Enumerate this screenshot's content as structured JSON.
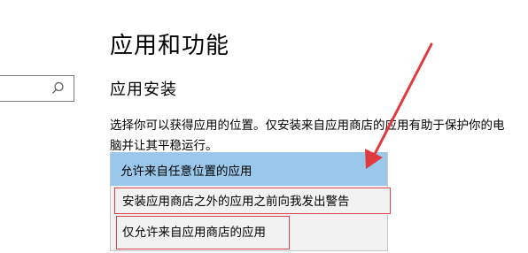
{
  "page": {
    "title": "应用和功能"
  },
  "search": {
    "value": "",
    "icon": "search-icon"
  },
  "install": {
    "section_title": "应用安装",
    "description": "选择你可以获得应用的位置。仅安装来自应用商店的应用有助于保护你的电脑并让其平稳运行。",
    "options": [
      {
        "label": "允许来自任意位置的应用",
        "state": "highlighted"
      },
      {
        "label": "安装应用商店之外的应用之前向我发出警告",
        "state": "annotated"
      },
      {
        "label": "仅允许来自应用商店的应用",
        "state": "annotated"
      }
    ]
  },
  "colors": {
    "highlight": "#99c8ea",
    "annotation_red": "#e03a3e",
    "dropdown_bg": "#f2f2f2"
  }
}
